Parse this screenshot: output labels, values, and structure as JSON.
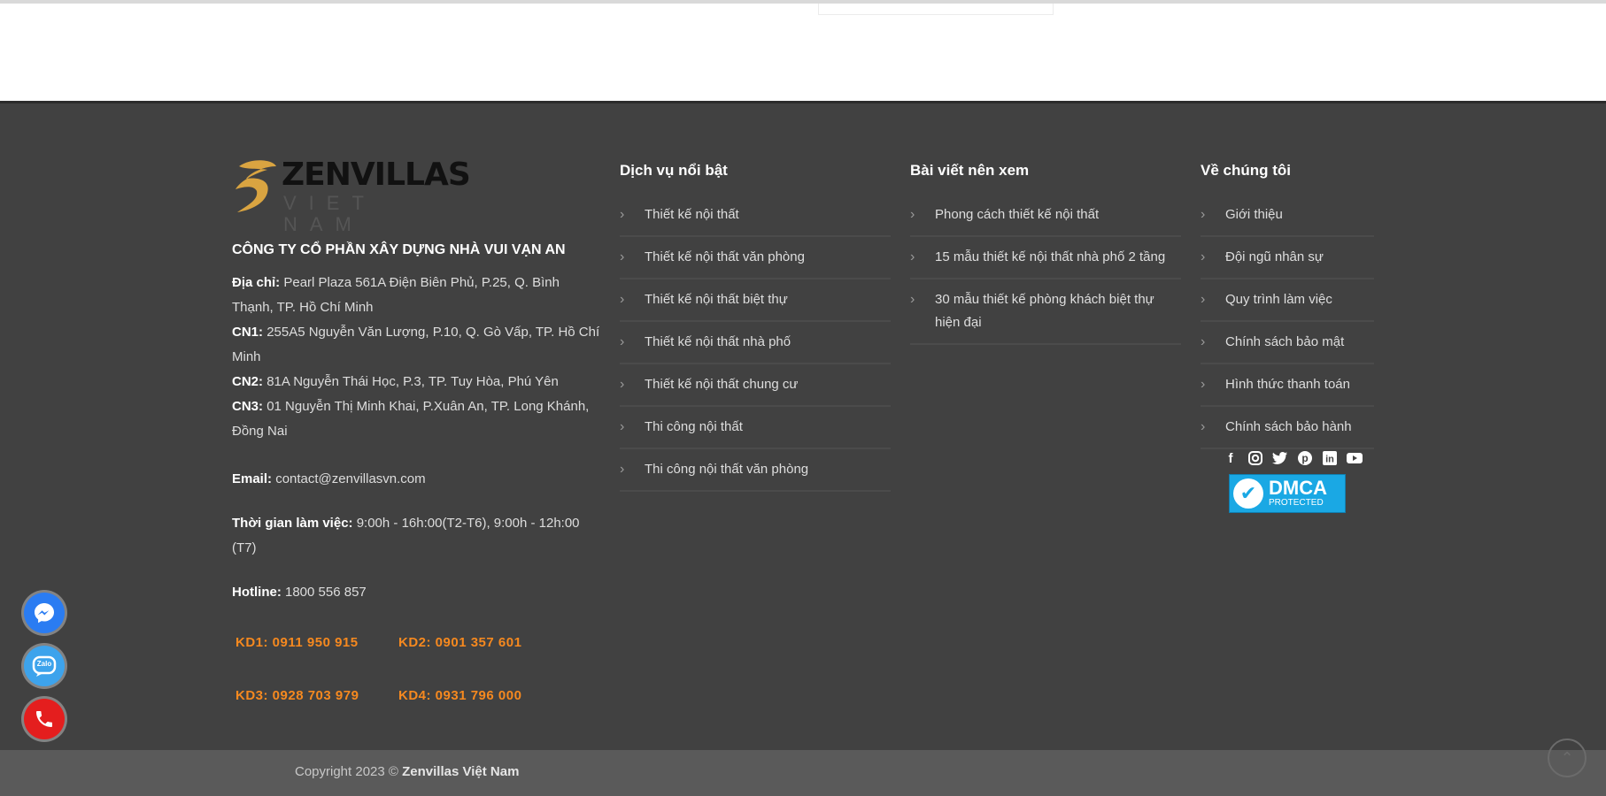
{
  "logo": {
    "name": "ZENVILLAS",
    "sub": "VIET   NAM"
  },
  "company": {
    "name": "CÔNG TY CỔ PHẦN XÂY DỰNG NHÀ VUI VẠN AN",
    "address_label": "Địa chỉ:",
    "address": "Pearl Plaza 561A Điện Biên Phủ, P.25, Q. Bình Thạnh, TP. Hồ Chí Minh",
    "cn1_label": "CN1:",
    "cn1": "255A5 Nguyễn Văn Lượng, P.10, Q. Gò Vấp, TP. Hồ Chí Minh",
    "cn2_label": "CN2:",
    "cn2": "81A Nguyễn Thái Học, P.3, TP. Tuy Hòa, Phú Yên",
    "cn3_label": "CN3:",
    "cn3": "01 Nguyễn Thị Minh Khai, P.Xuân An, TP. Long Khánh, Đồng Nai",
    "email_label": "Email:",
    "email": "contact@zenvillasvn.com",
    "hours_label": "Thời gian làm việc:",
    "hours": "9:00h - 16h:00(T2-T6), 9:00h - 12h:00 (T7)",
    "hotline_label": "Hotline:",
    "hotline": "1800 556 857",
    "kd1": "KD1: 0911 950 915",
    "kd2": "KD2: 0901 357 601",
    "kd3": "KD3: 0928 703 979",
    "kd4": "KD4: 0931 796 000"
  },
  "col1": {
    "title": "Dịch vụ nổi bật",
    "items": [
      "Thiết kế nội thất",
      "Thiết kế nội thất văn phòng",
      "Thiết kế nội thất biệt thự",
      "Thiết kế nội thất nhà phố",
      "Thiết kế nội thất chung cư",
      "Thi công nội thất",
      "Thi công nội thất văn phòng"
    ]
  },
  "col2": {
    "title": "Bài viết nên xem",
    "items": [
      "Phong cách thiết kế nội thất",
      "15 mẫu thiết kế nội thất nhà phố 2 tầng",
      "30 mẫu thiết kế phòng khách biệt thự hiện đại"
    ]
  },
  "col3": {
    "title": "Về chúng tôi",
    "items": [
      "Giới thiệu",
      "Đội ngũ nhân sự",
      "Quy trình làm việc",
      "Chính sách bảo mật",
      "Hình thức thanh toán",
      "Chính sách bảo hành"
    ]
  },
  "social": [
    "facebook-icon",
    "instagram-icon",
    "twitter-icon",
    "pinterest-icon",
    "linkedin-icon",
    "youtube-icon"
  ],
  "dmca": {
    "main": "DMCA",
    "sub": "PROTECTED"
  },
  "copyright": {
    "prefix": "Copyright 2023 ©",
    "brand": "Zenvillas Việt Nam"
  },
  "float_buttons": {
    "zalo": "Zalo"
  },
  "colors": {
    "footer_bg": "#414141",
    "accent": "#f6891f",
    "dmca": "#1aa8e4",
    "messenger": "#2a7cf2",
    "zalo": "#3da3ec",
    "phone": "#e41e1e"
  }
}
